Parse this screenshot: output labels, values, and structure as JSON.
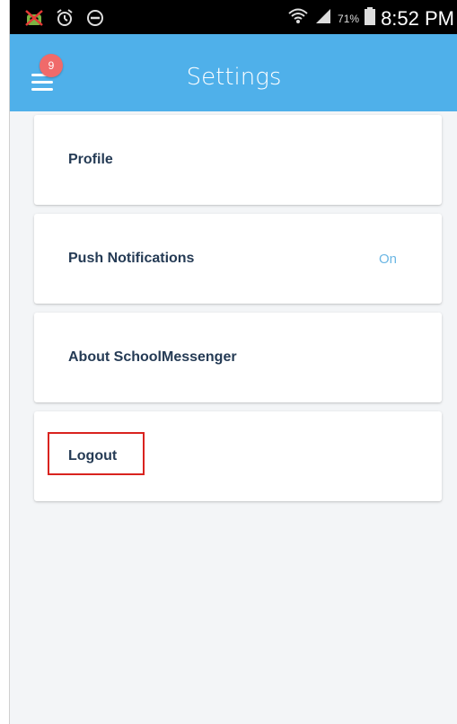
{
  "status_bar": {
    "time": "8:52 PM",
    "battery_percent": "71%",
    "icons": [
      "android-debug-icon",
      "alarm-icon",
      "do-not-disturb-icon",
      "wifi-icon",
      "signal-icon",
      "battery-icon"
    ]
  },
  "header": {
    "title": "Settings",
    "notification_count": "9",
    "color": "#4fb0ea"
  },
  "settings": {
    "items": [
      {
        "label": "Profile",
        "value": ""
      },
      {
        "label": "Push Notifications",
        "value": "On"
      },
      {
        "label": "About SchoolMessenger",
        "value": ""
      },
      {
        "label": "Logout",
        "value": ""
      }
    ]
  },
  "colors": {
    "label": "#253b55",
    "value": "#6cb7e4",
    "highlight": "#d9231f",
    "background": "#f3f5f7"
  }
}
